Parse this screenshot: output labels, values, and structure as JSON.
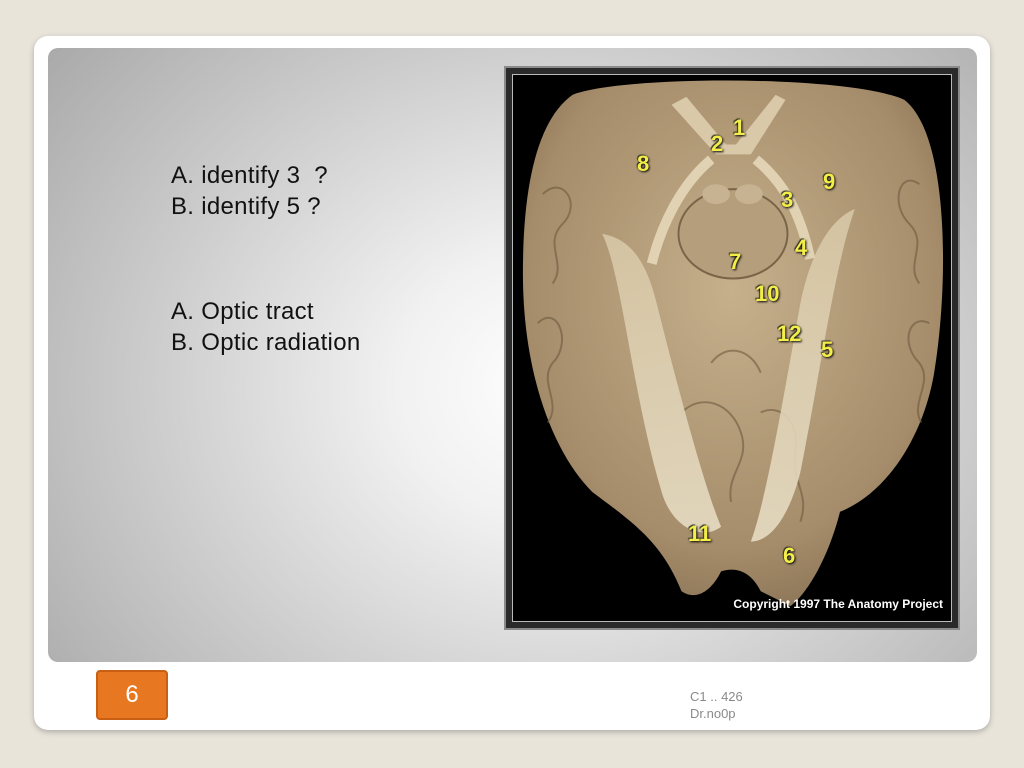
{
  "slide": {
    "questions": [
      "A. identify 3  ?",
      "B. identify 5 ?"
    ],
    "answers": [
      "A. Optic tract",
      "B. Optic radiation"
    ],
    "page_number": "6",
    "footer": [
      "C1 .. 426",
      "Dr.no0p"
    ]
  },
  "figure": {
    "labels": [
      "1",
      "2",
      "3",
      "4",
      "5",
      "6",
      "7",
      "8",
      "9",
      "10",
      "11",
      "12"
    ],
    "copyright": "Copyright 1997 The Anatomy Project"
  },
  "colors": {
    "badge": "#e87722",
    "label": "#f3ee4a",
    "tissue": "#b19a7a"
  }
}
